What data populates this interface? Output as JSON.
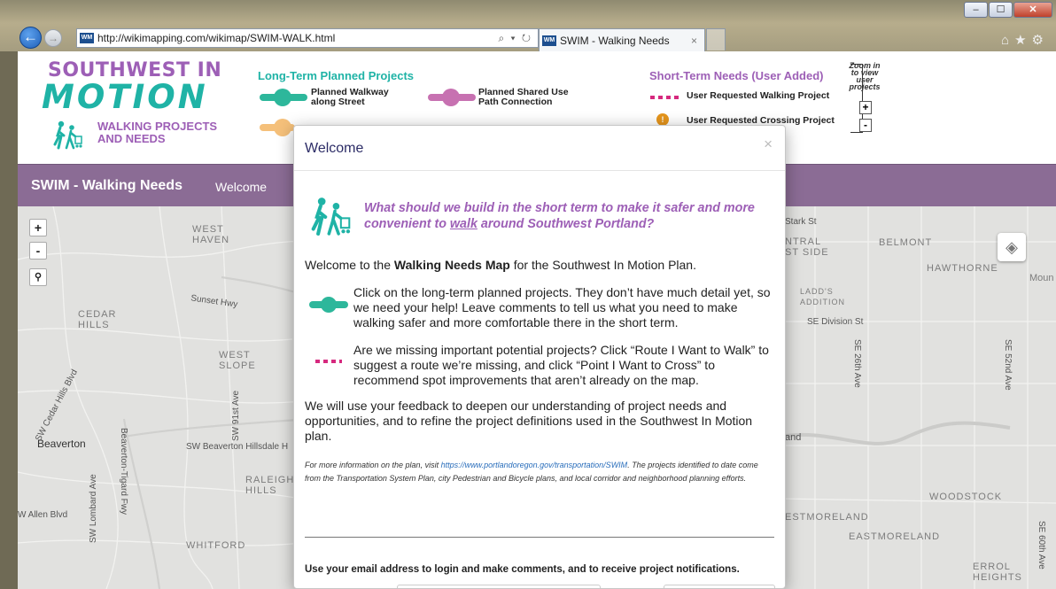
{
  "browser": {
    "url": "http://wikimapping.com/wikimap/SWIM-WALK.html",
    "url_tools": "⌕ ▾ ↻",
    "favicon": "WM",
    "tab_title": "SWIM - Walking Needs",
    "tab_close": "×",
    "window_buttons": [
      "‒",
      "☐",
      "✕"
    ],
    "nav_back": "←",
    "nav_fwd": "→",
    "right_icons": "⌂★⚙"
  },
  "header": {
    "logo_line1": "SOUTHWEST IN",
    "logo_line2": "MOTION",
    "logo_line3": "WALKING PROJECTS",
    "logo_line4": "AND NEEDS",
    "long_term_title": "Long-Term Planned Projects",
    "legend_walkway": "Planned Walkway along Street",
    "legend_shared_path": "Planned Shared Use Path Connection",
    "short_term_title": "Short-Term Needs (User Added)",
    "legend_user_walking": "User Requested Walking Project",
    "legend_user_crossing": "User Requested Crossing Project",
    "zoom_note": "Zoom in to view user projects",
    "zoom_in": "+",
    "zoom_out": "-",
    "colors": {
      "teal": "#1fb3a6",
      "purple": "#9d5fb6",
      "pink": "#d6297e",
      "orange": "#f5c07a"
    }
  },
  "bar": {
    "title": "SWIM - Walking Needs",
    "welcome_link": "Welcome"
  },
  "map": {
    "zoom_in": "+",
    "zoom_out": "-",
    "search_icon": "🔍",
    "layers_icon": "layers-icon",
    "labels": {
      "west_haven": "WEST\nHAVEN",
      "cedar_hills": "CEDAR\nHILLS",
      "west_slope": "WEST\nSLOPE",
      "sunset_hwy": "Sunset Hwy",
      "beaverton": "Beaverton",
      "raleigh_hills": "RALEIGH\nHILLS",
      "whitford": "WHITFORD",
      "sw_cedar_hills_blvd": "SW Cedar Hills Blvd",
      "sw_91st_ave": "SW 91st Ave",
      "beaverton_tigard": "Beaverton-Tigard Fwy",
      "sw_lombard_ave": "SW Lombard Ave",
      "sw_beaverton_hillsdale": "SW Beaverton Hillsdale H",
      "allen_blvd": "W Allen Blvd",
      "stark_st": "Stark St",
      "central_eastside": "NTRAL\nST SIDE",
      "belmont": "BELMONT",
      "hawthorne": "HAWTHORNE",
      "mount": "Moun",
      "ladds_addition": "LADD'S\nADDITION",
      "se_division": "SE Division St",
      "se_26th": "SE 26th Ave",
      "se_52nd": "SE 52nd Ave",
      "and": "and",
      "woodstock": "WOODSTOCK",
      "eastmoreland_cap": "ESTMORELAND",
      "eastmoreland": "EASTMORELAND",
      "se_60th": "SE 60th Ave",
      "errol_heights": "ERROL\nHEIGHTS"
    }
  },
  "modal": {
    "title": "Welcome",
    "close": "×",
    "question_pre": "What should we build in the short term to make it safer and more convenient to ",
    "question_word": "walk",
    "question_post": " around Southwest Portland?",
    "p1_pre": "Welcome to the ",
    "p1_bold": "Walking Needs Map",
    "p1_post": " for the Southwest In Motion Plan.",
    "p2": "Click on the long-term planned projects. They don’t have much detail yet, so we need your help! Leave comments to tell us what you need to make walking safer and more comfortable there in the short term.",
    "p3": "Are we missing important potential projects? Click “Route I Want to Walk” to suggest a route we’re missing, and click “Point I Want to Cross” to recommend spot improvements that aren’t already on the map.",
    "p4": "We will use your feedback to deepen our understanding of project needs and opportunities, and to refine the project definitions used in the Southwest In Motion plan.",
    "fine_pre": "For more information on the plan, visit ",
    "fine_link": "https://www.portlandoregon.gov/transportation/SWIM",
    "fine_post": ". The projects identified to date come from the Transportation System Plan, city Pedestrian and Bicycle plans, and local corridor and neighborhood planning efforts.",
    "login_text": "Use your email address to login and make comments, and to receive project notifications."
  }
}
